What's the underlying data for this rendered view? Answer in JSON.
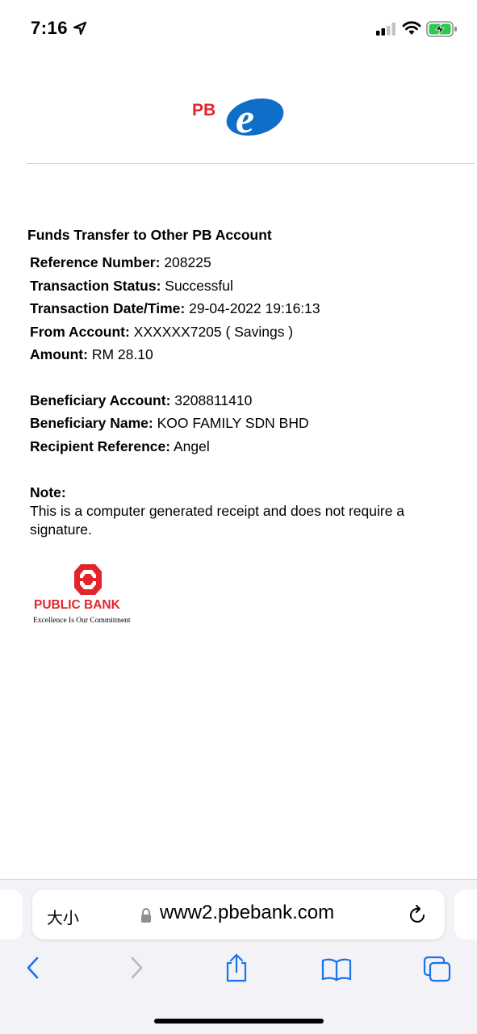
{
  "status_bar": {
    "time": "7:16",
    "icons": [
      "location-arrow-icon",
      "cellular-signal-icon",
      "wifi-icon",
      "battery-charging-icon"
    ]
  },
  "header": {
    "logo_text_pb": "PB",
    "logo_text_e": "e"
  },
  "receipt": {
    "title": "Funds Transfer to Other PB Account",
    "rows": [
      {
        "label": "Reference Number:",
        "value": "208225"
      },
      {
        "label": "Transaction Status:",
        "value": "Successful"
      },
      {
        "label": "Transaction Date/Time:",
        "value": "29-04-2022 19:16:13"
      },
      {
        "label": "From Account:",
        "value": "XXXXXX7205 ( Savings )"
      },
      {
        "label": "Amount:",
        "value": "RM 28.10"
      }
    ],
    "beneficiary_rows": [
      {
        "label": "Beneficiary Account:",
        "value": "3208811410"
      },
      {
        "label": "Beneficiary Name:",
        "value": "KOO FAMILY SDN BHD"
      },
      {
        "label": "Recipient Reference:",
        "value": "Angel"
      }
    ],
    "note_title": "Note:",
    "note_text": "This is a computer generated receipt and does not require a signature."
  },
  "footer_logo": {
    "bank_name": "PUBLIC BANK",
    "tagline": "Excellence Is Our Commitment"
  },
  "browser": {
    "size_button": "大小",
    "url": "www2.pbebank.com"
  },
  "colors": {
    "pb_red": "#e3242b",
    "pb_blue": "#0f6ec8",
    "ios_blue": "#1a73e8",
    "ios_gray_disabled": "#b8b8bd",
    "battery_green": "#30c84a"
  }
}
